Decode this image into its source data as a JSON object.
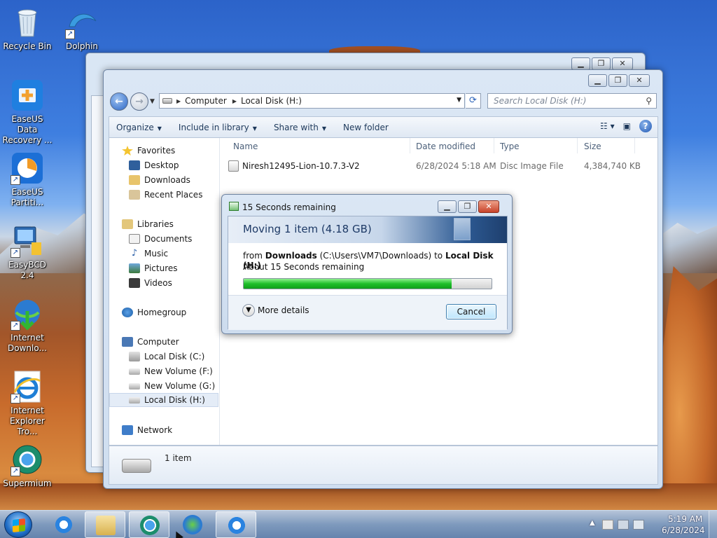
{
  "desktop": {
    "icons": [
      {
        "label": "Recycle Bin",
        "icon": "recycle-bin-icon"
      },
      {
        "label": "Dolphin",
        "icon": "dolphin-icon"
      },
      {
        "label": "EaseUS Data Recovery ...",
        "icon": "easeus-data-recovery-icon"
      },
      {
        "label": "EaseUS Partiti...",
        "icon": "easeus-partition-icon"
      },
      {
        "label": "EasyBCD 2.4",
        "icon": "easybcd-icon"
      },
      {
        "label": "Internet Downlo...",
        "icon": "internet-download-manager-icon"
      },
      {
        "label": "Internet Explorer Tro...",
        "icon": "internet-explorer-icon"
      },
      {
        "label": "Supermium",
        "icon": "supermium-icon"
      }
    ]
  },
  "explorer": {
    "address": {
      "root": "Computer",
      "current": "Local Disk (H:)"
    },
    "search_placeholder": "Search Local Disk (H:)",
    "toolbar": {
      "organize": "Organize",
      "include_in_library": "Include in library",
      "share_with": "Share with",
      "new_folder": "New folder"
    },
    "navpane": {
      "favorites": "Favorites",
      "desktop": "Desktop",
      "downloads": "Downloads",
      "recent_places": "Recent Places",
      "libraries": "Libraries",
      "documents": "Documents",
      "music": "Music",
      "pictures": "Pictures",
      "videos": "Videos",
      "homegroup": "Homegroup",
      "computer": "Computer",
      "local_c": "Local Disk (C:)",
      "new_volume_f": "New Volume (F:)",
      "new_volume_g": "New Volume (G:)",
      "local_h": "Local Disk (H:)",
      "network": "Network"
    },
    "columns": {
      "name": "Name",
      "date_modified": "Date modified",
      "type": "Type",
      "size": "Size"
    },
    "files": [
      {
        "name": "Niresh12495-Lion-10.7.3-V2",
        "date_modified": "6/28/2024 5:18 AM",
        "type": "Disc Image File",
        "size": "4,384,740 KB"
      }
    ],
    "status": {
      "items": "1 item"
    }
  },
  "copy_dialog": {
    "title": "15 Seconds remaining",
    "header": "Moving 1 item (4.18 GB)",
    "from_label": "from",
    "source": "Downloads",
    "source_path": "(C:\\Users\\VM7\\Downloads)",
    "to_label": "to",
    "destination": "Local Disk (H:)",
    "remaining": "About 15 Seconds remaining",
    "progress_percent": 84,
    "more_details": "More details",
    "cancel": "Cancel"
  },
  "taskbar": {
    "time": "5:19 AM",
    "date": "6/28/2024",
    "buttons": [
      "internet-explorer-icon",
      "file-explorer-icon",
      "supermium-icon",
      "internet-download-manager-icon",
      "internet-explorer-icon"
    ]
  }
}
